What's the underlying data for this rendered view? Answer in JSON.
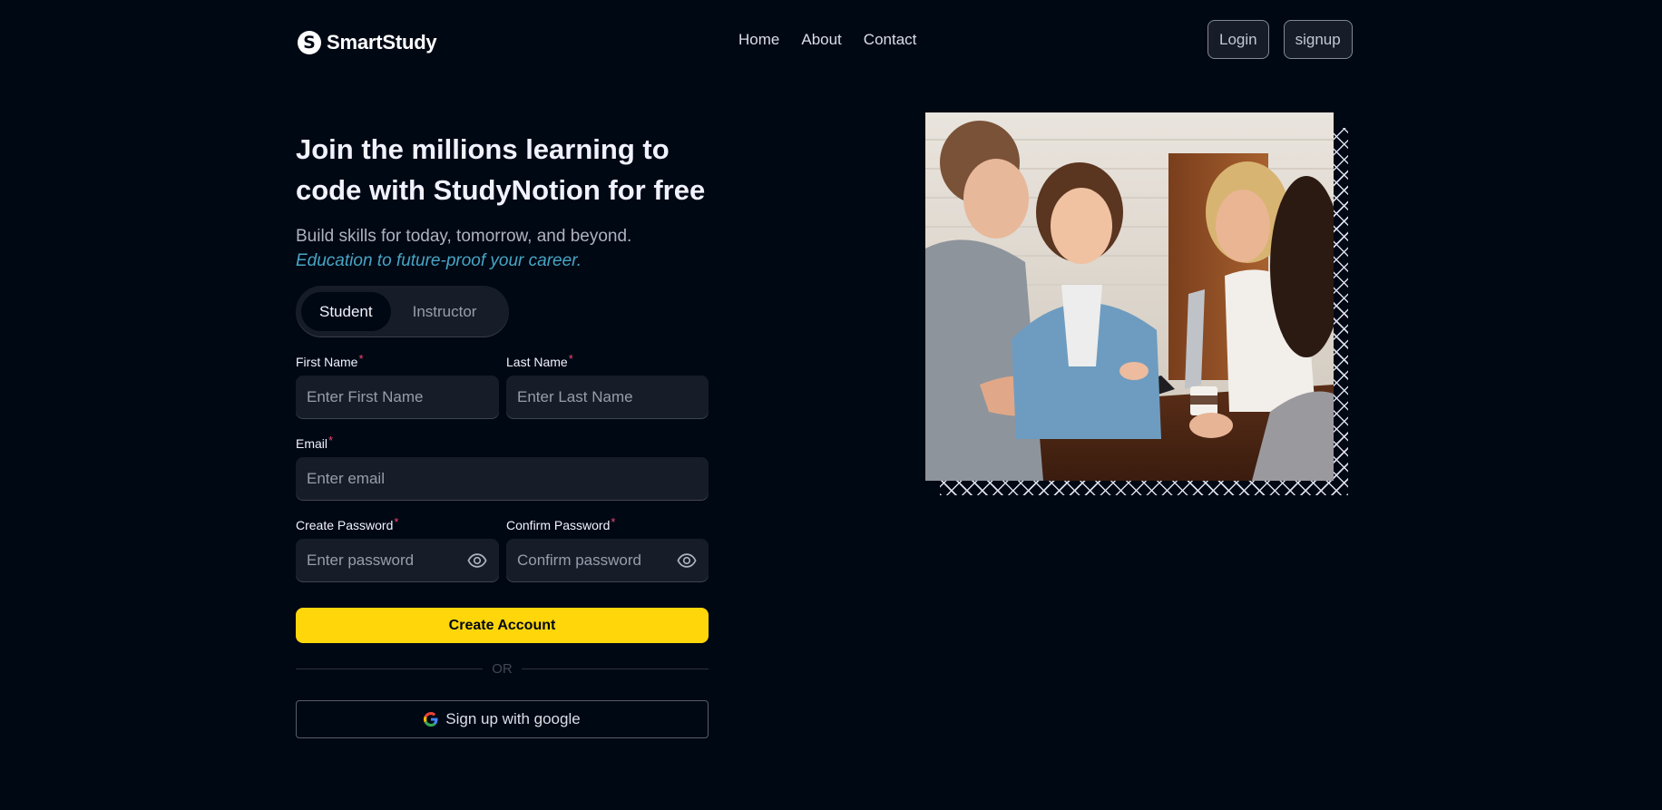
{
  "brand": {
    "name": "SmartStudy",
    "logo_letter": "S"
  },
  "nav": {
    "links": [
      "Home",
      "About",
      "Contact"
    ],
    "login": "Login",
    "signup": "signup"
  },
  "hero": {
    "title": "Join the millions learning to code with StudyNotion for free",
    "subtitle": "Build skills for today, tomorrow, and beyond.",
    "highlight": "Education to future-proof your career."
  },
  "role_tabs": {
    "student": "Student",
    "instructor": "Instructor",
    "selected": "Student"
  },
  "form": {
    "first_name": {
      "label": "First Name",
      "placeholder": "Enter First Name",
      "value": ""
    },
    "last_name": {
      "label": "Last Name",
      "placeholder": "Enter Last Name",
      "value": ""
    },
    "email": {
      "label": "Email",
      "placeholder": "Enter email",
      "value": ""
    },
    "password": {
      "label": "Create Password",
      "placeholder": "Enter password",
      "value": ""
    },
    "confirm_password": {
      "label": "Confirm Password",
      "placeholder": "Confirm password",
      "value": ""
    },
    "required_mark": "*",
    "submit": "Create Account",
    "or": "OR",
    "google": "Sign up with google"
  },
  "icons": {
    "logo": "logo-s-icon",
    "password_toggle": "eye-icon",
    "google": "google-g-icon"
  },
  "colors": {
    "background": "#000814",
    "accent_yellow": "#FFD60A",
    "highlight_blue": "#47A5C5",
    "required_pink": "#EF476F",
    "input_bg": "#161D29"
  }
}
